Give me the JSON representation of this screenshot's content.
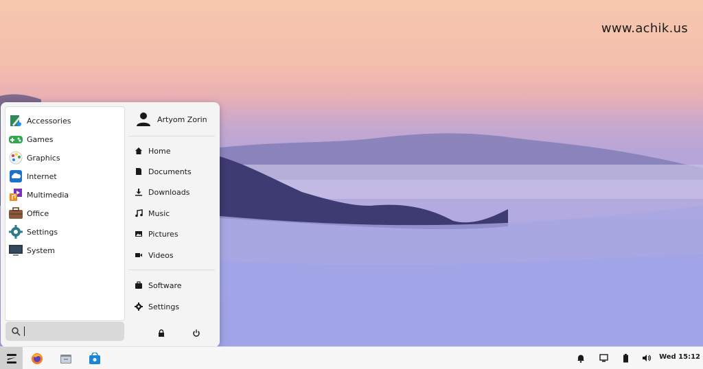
{
  "watermark": "www.achik.us",
  "menu": {
    "categories": [
      {
        "label": "Accessories",
        "icon": "accessories-icon"
      },
      {
        "label": "Games",
        "icon": "games-icon"
      },
      {
        "label": "Graphics",
        "icon": "graphics-icon"
      },
      {
        "label": "Internet",
        "icon": "internet-icon"
      },
      {
        "label": "Multimedia",
        "icon": "multimedia-icon"
      },
      {
        "label": "Office",
        "icon": "office-icon"
      },
      {
        "label": "Settings",
        "icon": "settings-icon"
      },
      {
        "label": "System",
        "icon": "system-icon"
      }
    ],
    "user_name": "Artyom Zorin",
    "places": [
      {
        "label": "Home",
        "icon": "home-icon"
      },
      {
        "label": "Documents",
        "icon": "document-icon"
      },
      {
        "label": "Downloads",
        "icon": "download-icon"
      },
      {
        "label": "Music",
        "icon": "music-icon"
      },
      {
        "label": "Pictures",
        "icon": "picture-icon"
      },
      {
        "label": "Videos",
        "icon": "video-icon"
      }
    ],
    "system_items": [
      {
        "label": "Software",
        "icon": "software-icon"
      },
      {
        "label": "Settings",
        "icon": "gear-icon"
      }
    ],
    "search": {
      "value": ""
    }
  },
  "taskbar": {
    "clock": "Wed 15:12",
    "apps": [
      "zorin-menu-icon",
      "firefox-icon",
      "files-icon",
      "software-store-icon"
    ],
    "tray": [
      "bell-icon",
      "display-icon",
      "battery-icon",
      "volume-icon"
    ]
  },
  "colors": {
    "accent": "#1a73c8",
    "wallpaper_top": "#f6c7ad",
    "wallpaper_bottom": "#9fa6e6"
  }
}
